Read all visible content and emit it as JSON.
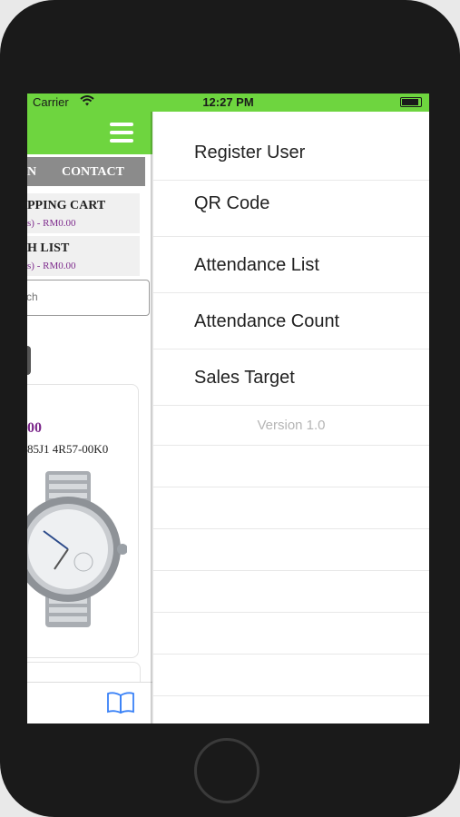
{
  "status_bar": {
    "carrier": "Carrier",
    "time": "12:27 PM"
  },
  "background_app": {
    "nav": [
      "N",
      "CONTACT"
    ],
    "cart": {
      "title": "PPING CART",
      "subtitle": "s) - RM0.00"
    },
    "wishlist": {
      "title": "H LIST",
      "subtitle": "s) - RM0.00"
    },
    "search_placeholder": "ch",
    "product": {
      "price": "00",
      "code": "85J1 4R57-00K0"
    },
    "accent_color": "#6ed53f",
    "price_color": "#7d2a8c"
  },
  "drawer": {
    "items": [
      {
        "label": "Register User"
      },
      {
        "label": "QR Code"
      },
      {
        "label": "Attendance List"
      },
      {
        "label": "Attendance Count"
      },
      {
        "label": "Sales Target"
      }
    ],
    "version": "Version 1.0"
  },
  "icons": [
    "wifi-icon",
    "battery-icon",
    "hamburger-menu-icon",
    "book-icon",
    "home-button"
  ]
}
